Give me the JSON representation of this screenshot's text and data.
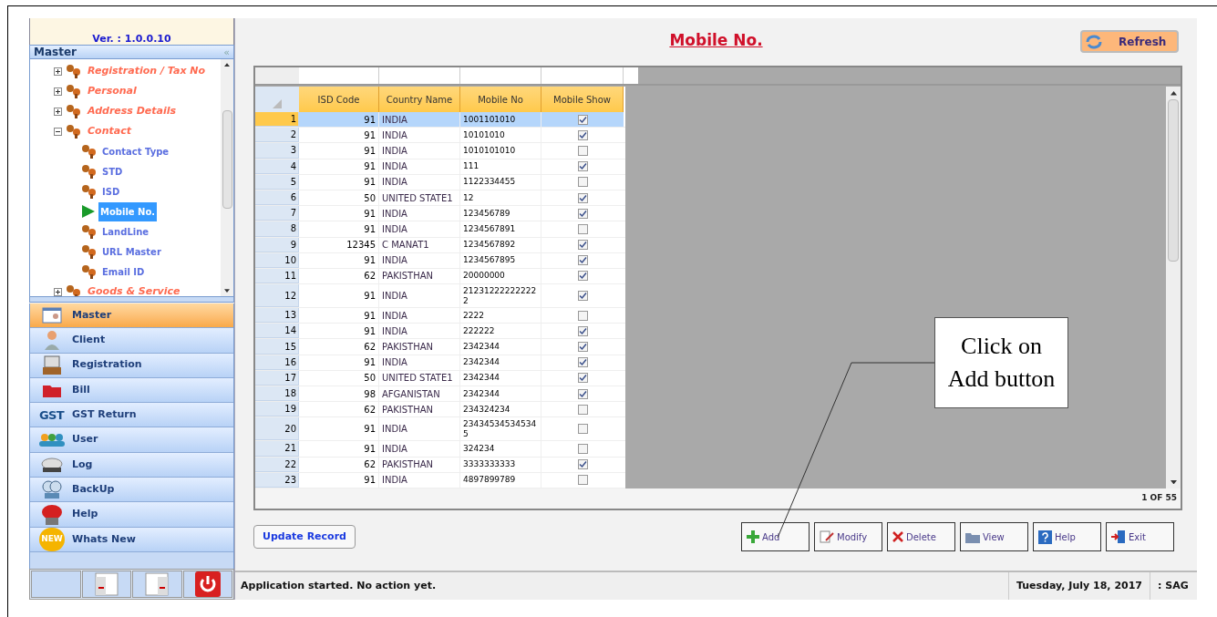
{
  "sidebar": {
    "version": "Ver. : 1.0.0.10",
    "panel_title": "Master",
    "collapse_glyph": "«",
    "tree": [
      {
        "label": "Registration / Tax No",
        "expanded": false,
        "selected": false
      },
      {
        "label": "Personal",
        "expanded": false,
        "selected": false
      },
      {
        "label": "Address Details",
        "expanded": false,
        "selected": false
      },
      {
        "label": "Contact",
        "expanded": true,
        "selected": false,
        "children": [
          {
            "label": "Contact Type",
            "selected": false
          },
          {
            "label": "STD",
            "selected": false
          },
          {
            "label": "ISD",
            "selected": false
          },
          {
            "label": "Mobile No.",
            "selected": true
          },
          {
            "label": "LandLine",
            "selected": false
          },
          {
            "label": "URL Master",
            "selected": false
          },
          {
            "label": "Email ID",
            "selected": false
          }
        ]
      },
      {
        "label": "Goods & Service",
        "expanded": false,
        "selected": false
      }
    ],
    "nav": [
      {
        "label": "Master",
        "kind": "master",
        "selected": true
      },
      {
        "label": "Client",
        "kind": "client",
        "selected": false
      },
      {
        "label": "Registration",
        "kind": "register",
        "selected": false
      },
      {
        "label": "Bill",
        "kind": "bill",
        "selected": false
      },
      {
        "label": "GST Return",
        "kind": "gst",
        "selected": false,
        "icon_text": "GST"
      },
      {
        "label": "User",
        "kind": "user",
        "selected": false
      },
      {
        "label": "Log",
        "kind": "log",
        "selected": false
      },
      {
        "label": "BackUp",
        "kind": "backup",
        "selected": false
      },
      {
        "label": "Help",
        "kind": "help",
        "selected": false
      },
      {
        "label": "Whats New",
        "kind": "new",
        "selected": false,
        "icon_text": "NEW"
      }
    ]
  },
  "main": {
    "title": "Mobile No.",
    "refresh": "Refresh",
    "table": {
      "columns": [
        "ISD Code",
        "Country Name",
        "Mobile No",
        "Mobile Show"
      ],
      "rows": [
        {
          "n": "1",
          "isd": "91",
          "country": "INDIA",
          "mobile": "1001101010",
          "checked": true,
          "selected": true
        },
        {
          "n": "2",
          "isd": "91",
          "country": "INDIA",
          "mobile": "10101010",
          "checked": true,
          "selected": false
        },
        {
          "n": "3",
          "isd": "91",
          "country": "INDIA",
          "mobile": "1010101010",
          "checked": false,
          "selected": false
        },
        {
          "n": "4",
          "isd": "91",
          "country": "INDIA",
          "mobile": "111",
          "checked": true,
          "selected": false
        },
        {
          "n": "5",
          "isd": "91",
          "country": "INDIA",
          "mobile": "1122334455",
          "checked": false,
          "selected": false
        },
        {
          "n": "6",
          "isd": "50",
          "country": "UNITED STATE1",
          "mobile": "12",
          "checked": true,
          "selected": false
        },
        {
          "n": "7",
          "isd": "91",
          "country": "INDIA",
          "mobile": "123456789",
          "checked": true,
          "selected": false
        },
        {
          "n": "8",
          "isd": "91",
          "country": "INDIA",
          "mobile": "1234567891",
          "checked": false,
          "selected": false
        },
        {
          "n": "9",
          "isd": "12345",
          "country": "C MANAT1",
          "mobile": "1234567892",
          "checked": true,
          "selected": false
        },
        {
          "n": "10",
          "isd": "91",
          "country": "INDIA",
          "mobile": "1234567895",
          "checked": true,
          "selected": false
        },
        {
          "n": "11",
          "isd": "62",
          "country": "PAKISTHAN",
          "mobile": "20000000",
          "checked": true,
          "selected": false
        },
        {
          "n": "12",
          "isd": "91",
          "country": "INDIA",
          "mobile": "21231222222222 2",
          "checked": true,
          "selected": false
        },
        {
          "n": "13",
          "isd": "91",
          "country": "INDIA",
          "mobile": "2222",
          "checked": false,
          "selected": false
        },
        {
          "n": "14",
          "isd": "91",
          "country": "INDIA",
          "mobile": "222222",
          "checked": true,
          "selected": false
        },
        {
          "n": "15",
          "isd": "62",
          "country": "PAKISTHAN",
          "mobile": "2342344",
          "checked": true,
          "selected": false
        },
        {
          "n": "16",
          "isd": "91",
          "country": "INDIA",
          "mobile": "2342344",
          "checked": true,
          "selected": false
        },
        {
          "n": "17",
          "isd": "50",
          "country": "UNITED STATE1",
          "mobile": "2342344",
          "checked": true,
          "selected": false
        },
        {
          "n": "18",
          "isd": "98",
          "country": "AFGANISTAN",
          "mobile": "2342344",
          "checked": true,
          "selected": false
        },
        {
          "n": "19",
          "isd": "62",
          "country": "PAKISTHAN",
          "mobile": "234324234",
          "checked": false,
          "selected": false
        },
        {
          "n": "20",
          "isd": "91",
          "country": "INDIA",
          "mobile": "23434534534534 5",
          "checked": false,
          "selected": false
        },
        {
          "n": "21",
          "isd": "91",
          "country": "INDIA",
          "mobile": "324234",
          "checked": false,
          "selected": false
        },
        {
          "n": "22",
          "isd": "62",
          "country": "PAKISTHAN",
          "mobile": "3333333333",
          "checked": true,
          "selected": false
        },
        {
          "n": "23",
          "isd": "91",
          "country": "INDIA",
          "mobile": "4897899789",
          "checked": false,
          "selected": false
        }
      ],
      "pager": "1 OF 55"
    },
    "update_button": "Update Record",
    "actions": [
      {
        "label": "Add",
        "kind": "add"
      },
      {
        "label": "Modify",
        "kind": "modify"
      },
      {
        "label": "Delete",
        "kind": "delete"
      },
      {
        "label": "View",
        "kind": "view"
      },
      {
        "label": "Help",
        "kind": "help"
      },
      {
        "label": "Exit",
        "kind": "exit"
      }
    ]
  },
  "status_bar": {
    "message": "Application started. No action yet.",
    "date": "Tuesday, July 18, 2017",
    "user": ": SAG"
  },
  "callout": {
    "text": "Click on Add button"
  }
}
